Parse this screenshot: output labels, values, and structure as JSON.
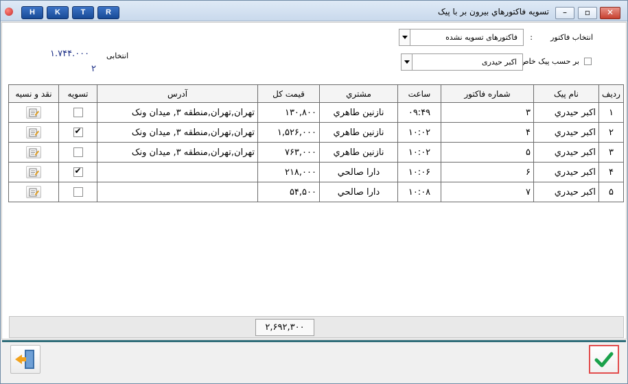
{
  "window": {
    "title": "تسويه فاكتورهاي بيرون بر با پيک",
    "hotkeys": [
      "H",
      "K",
      "T",
      "R"
    ],
    "controls": {
      "minimize": "–",
      "restore": "▫",
      "close": "✕"
    }
  },
  "filters": {
    "invoice_select_label": "انتخاب فاكتور",
    "invoice_select_colon": ":",
    "invoice_select_value": "فاكتورهای تسويه نشده",
    "courier_check_label": "بر حسب پيک خاص",
    "courier_colon": ":",
    "courier_value": "اكبر حيدری"
  },
  "selection": {
    "label": "انتخابی",
    "amount": "۱.۷۴۴.۰۰۰",
    "count": "۲"
  },
  "table": {
    "headers": [
      "رديف",
      "نام پيک",
      "شماره فاكتور",
      "ساعت",
      "مشتري",
      "قيمت كل",
      "آدرس",
      "تسويه",
      "نقد و نسيه"
    ],
    "rows": [
      {
        "no": "۱",
        "courier": "اكبر حيدري",
        "invoice": "۳",
        "time": "۰۹:۴۹",
        "customer": "نازنين طاهري",
        "total": "۱۳۰,۸۰۰",
        "address": "تهران,تهران,منطقه ۳, ميدان ونک",
        "settled": false
      },
      {
        "no": "۲",
        "courier": "اكبر حيدري",
        "invoice": "۴",
        "time": "۱۰:۰۲",
        "customer": "نازنين طاهري",
        "total": "۱,۵۲۶,۰۰۰",
        "address": "تهران,تهران,منطقه ۳, ميدان ونک",
        "settled": true
      },
      {
        "no": "۳",
        "courier": "اكبر حيدري",
        "invoice": "۵",
        "time": "۱۰:۰۲",
        "customer": "نازنين طاهري",
        "total": "۷۶۳,۰۰۰",
        "address": "تهران,تهران,منطقه ۳, ميدان ونک",
        "settled": false
      },
      {
        "no": "۴",
        "courier": "اكبر حيدري",
        "invoice": "۶",
        "time": "۱۰:۰۶",
        "customer": "دارا صالحي",
        "total": "۲۱۸,۰۰۰",
        "address": "",
        "settled": true
      },
      {
        "no": "۵",
        "courier": "اكبر حيدري",
        "invoice": "۷",
        "time": "۱۰:۰۸",
        "customer": "دارا صالحي",
        "total": "۵۴,۵۰۰",
        "address": "",
        "settled": false
      }
    ]
  },
  "footer": {
    "grand_total": "۲,۶۹۲,۳۰۰"
  },
  "icons": {
    "edit": "notepad-edit-icon",
    "exit": "exit-door-icon",
    "confirm": "checkmark-icon"
  },
  "colors": {
    "accent_blue": "#1c2f86",
    "confirm_green": "#1aa14a",
    "highlight_red": "#e24b4b",
    "separator": "#2f6d79"
  }
}
